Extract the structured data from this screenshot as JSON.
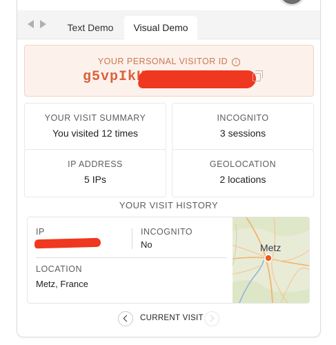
{
  "tabs": [
    {
      "label": "Text Demo"
    },
    {
      "label": "Visual Demo",
      "active": true
    }
  ],
  "visitor": {
    "label": "YOUR PERSONAL VISITOR ID",
    "id_visible": "g5vpIkHZ"
  },
  "stats": {
    "summary": {
      "label": "YOUR VISIT SUMMARY",
      "value": "You visited 12 times"
    },
    "incognito": {
      "label": "INCOGNITO",
      "value": "3 sessions"
    },
    "ip": {
      "label": "IP ADDRESS",
      "value": "5 IPs"
    },
    "geo": {
      "label": "GEOLOCATION",
      "value": "2 locations"
    }
  },
  "history": {
    "title": "YOUR VISIT HISTORY",
    "ip_label": "IP",
    "incognito_label": "INCOGNITO",
    "incognito_value": "No",
    "location_label": "LOCATION",
    "location_value": "Metz, France",
    "map_city": "Metz"
  },
  "pager": {
    "label": "CURRENT VISIT"
  },
  "colors": {
    "accent": "#d9623a",
    "accent_bg": "#fdf1ec",
    "redaction": "#f0371f"
  }
}
